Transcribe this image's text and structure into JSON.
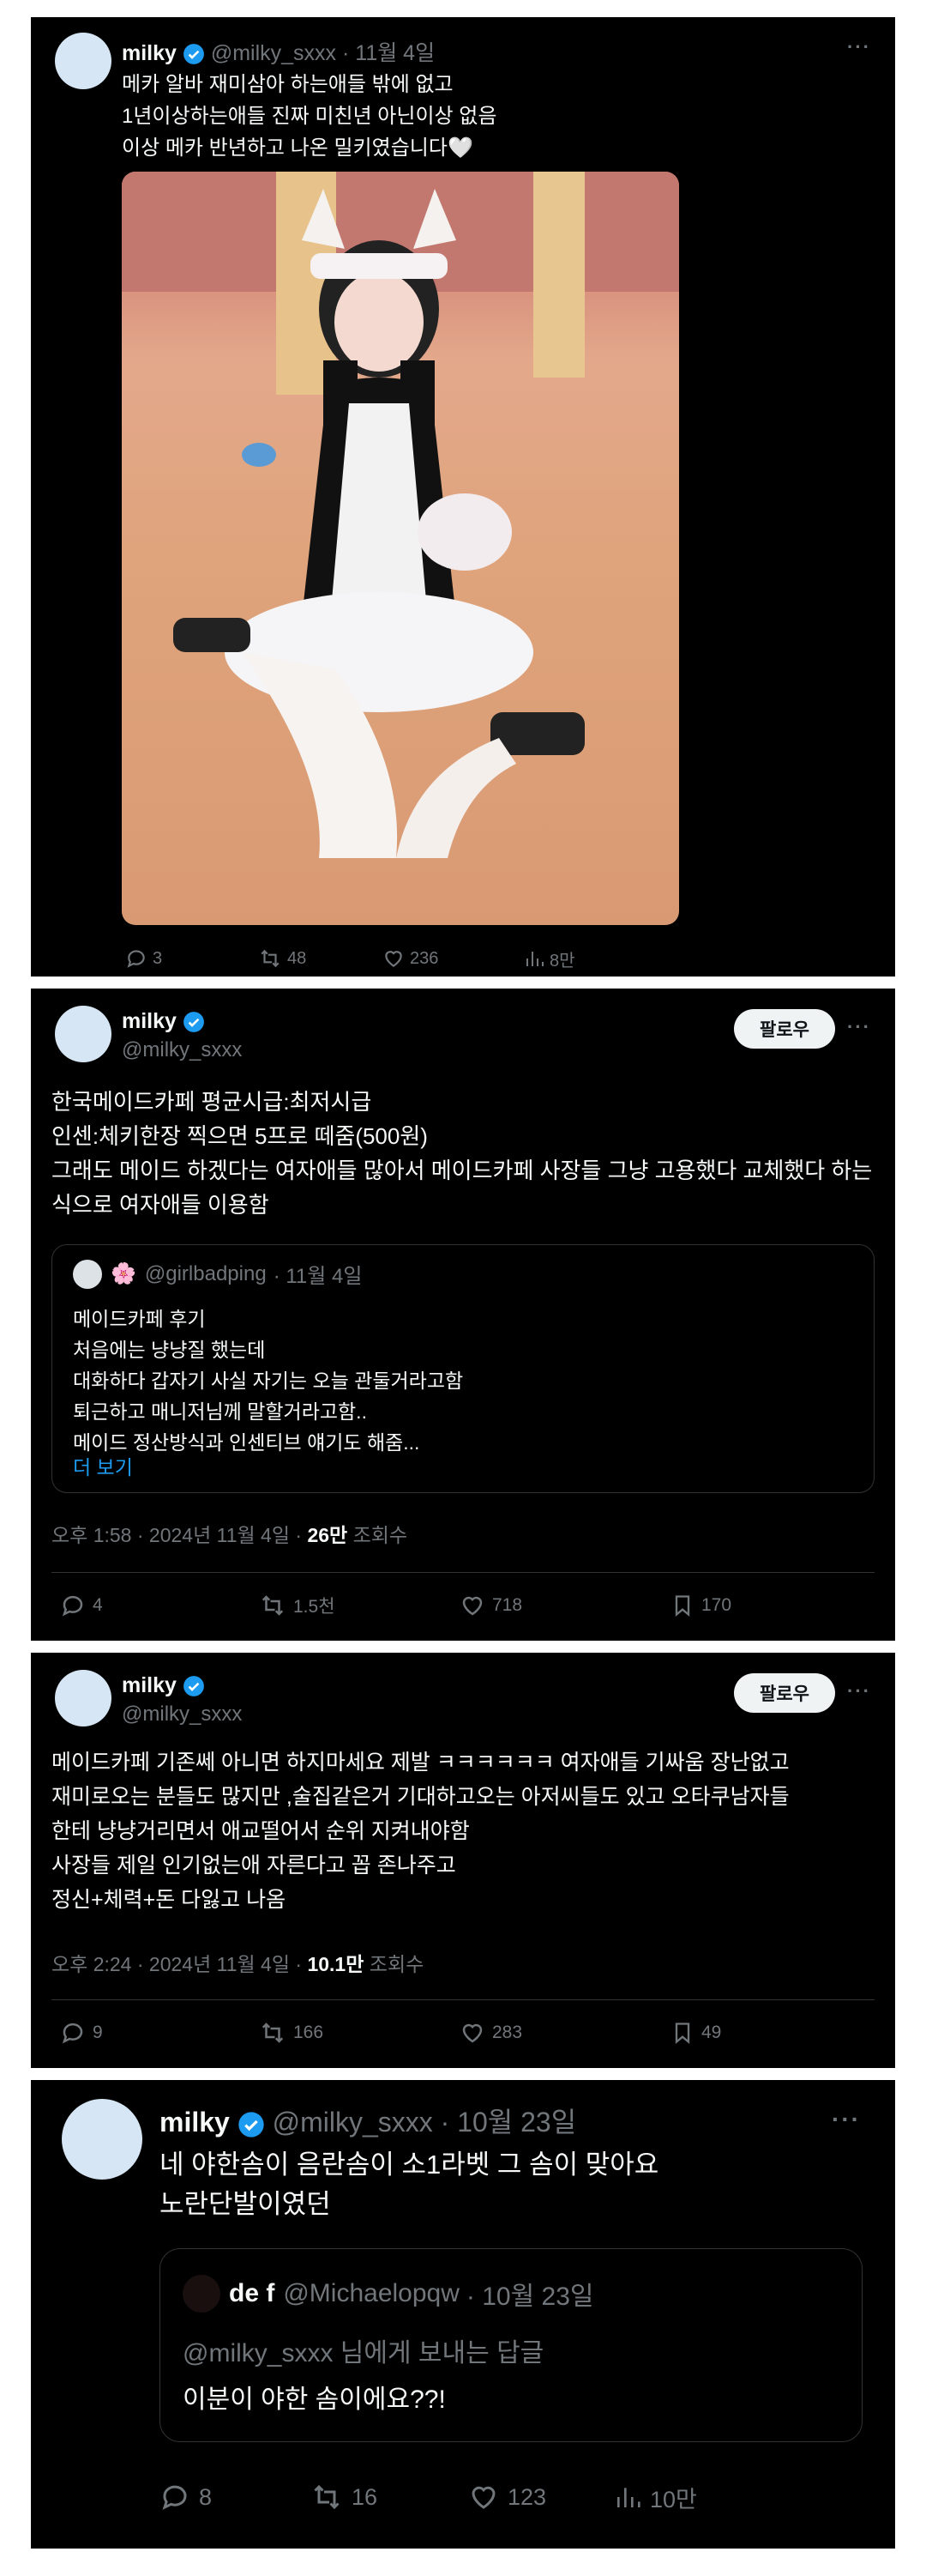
{
  "tweet1": {
    "name": "milky",
    "handle": "@milky_sxxx",
    "date": "· 11월 4일",
    "more": "···",
    "text": "메카 알바 재미삼아 하는애들 밖에 없고\n1년이상하는애들 진짜 미친년 아닌이상 없음\n이상 메카 반년하고 나온 밀키였습니다🤍",
    "image_alt": "photo",
    "replies": "3",
    "retweets": "48",
    "likes": "236",
    "views": "8만"
  },
  "tweet2": {
    "name": "milky",
    "handle": "@milky_sxxx",
    "follow": "팔로우",
    "more": "···",
    "text": "한국메이드카페 평균시급:최저시급\n인센:체키한장 찍으면 5프로 떼줌(500원)\n그래도 메이드 하겠다는 여자애들 많아서 메이드카페 사장들 그냥 고용했다 교체했다 하는식으로 여자애들 이용함",
    "quote": {
      "emoji": "🌸",
      "handle": "@girlbadping",
      "date": "· 11월 4일",
      "text": "메이드카페 후기\n처음에는 냥냥질 했는데\n대화하다 갑자기 사실 자기는 오늘 관둘거라고함\n퇴근하고 매니저님께 말할거라고함..\n메이드 정산방식과 인센티브 얘기도 해줌...",
      "more": "더 보기"
    },
    "time": "오후 1:58 · 2024년 11월 4일 · ",
    "views_count": "26만",
    "views_label": " 조회수",
    "replies": "4",
    "retweets": "1.5천",
    "likes": "718",
    "bookmarks": "170"
  },
  "tweet3": {
    "name": "milky",
    "handle": "@milky_sxxx",
    "follow": "팔로우",
    "more": "···",
    "text": "메이드카페 기존쎄 아니면 하지마세요 제발 ㅋㅋㅋㅋㅋㅋ 여자애들 기싸움 장난없고\n재미로오는 분들도 많지만 ,술집같은거 기대하고오는 아저씨들도 있고 오타쿠남자들\n한테 냥냥거리면서 애교떨어서 순위 지켜내야함\n사장들 제일 인기없는애 자른다고 꼽 존나주고\n정신+체력+돈 다잃고 나옴",
    "time": "오후 2:24 · 2024년 11월 4일 · ",
    "views_count": "10.1만",
    "views_label": " 조회수",
    "replies": "9",
    "retweets": "166",
    "likes": "283",
    "bookmarks": "49"
  },
  "tweet4": {
    "name": "milky",
    "handle": "@milky_sxxx",
    "date": "· 10월 23일",
    "more": "···",
    "text": "네 야한솜이 음란솜이 소1라벳 그 솜이 맞아요\n노란단발이였던",
    "quote": {
      "name": "de f",
      "handle": "@Michaelopqw",
      "date": "· 10월 23일",
      "reply_to": "@milky_sxxx 님에게 보내는 답글",
      "text": "이분이 야한 솜이에요??!"
    },
    "replies": "8",
    "retweets": "16",
    "likes": "123",
    "views": "10만"
  },
  "colors": {
    "background": "#000000",
    "verified": "#1d9bf0",
    "text": "#f7f9f9",
    "muted": "#71767b",
    "link": "#1d9bf0"
  },
  "icons": [
    "reply-icon",
    "retweet-icon",
    "like-icon",
    "views-icon",
    "bookmark-icon",
    "share-icon",
    "download-icon",
    "verified-icon"
  ]
}
